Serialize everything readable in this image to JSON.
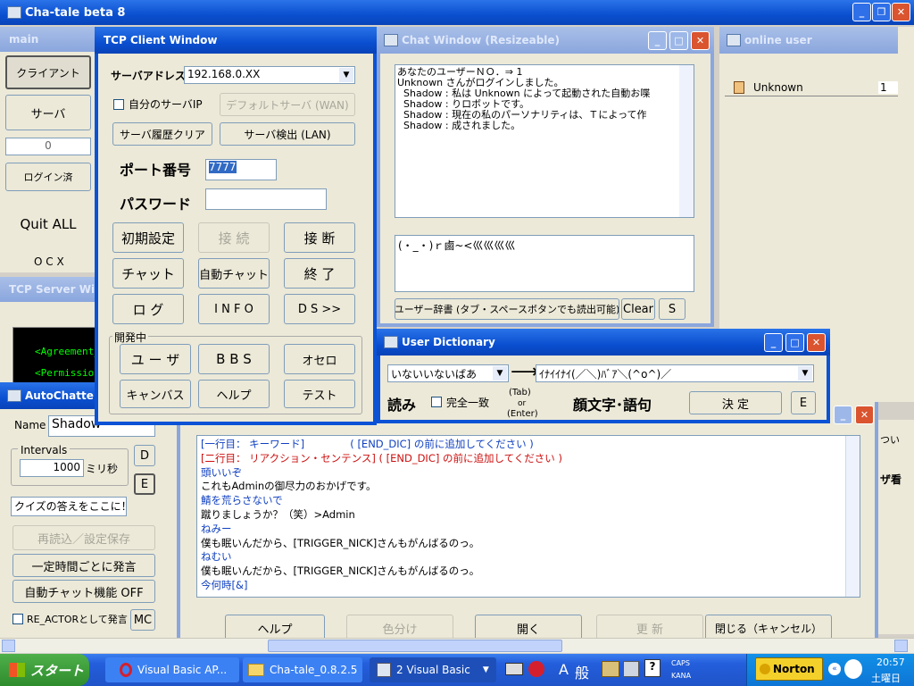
{
  "main_window": {
    "title": "Cha-tale beta 8"
  },
  "main_panel": {
    "title": "main",
    "client_button": "クライアント",
    "server_button": "サーバ",
    "counter": "0",
    "login_button": "ログイン済",
    "quit_button": "Quit ALL",
    "ocx_label": "O C X"
  },
  "server_window": {
    "title": "TCP Server Wi",
    "lines": [
      "<Agreement_",
      "<Permission"
    ]
  },
  "autochatter": {
    "title": "AutoChatte",
    "name_label": "Name :",
    "name_value": "Shadow",
    "intervals_label": "Intervals",
    "intervals_value": "1000",
    "ms_label": "ミリ秒",
    "d_button": "D",
    "e_button": "E",
    "quiz_input": "クイズの答えをここに！",
    "reload_button": "再読込／設定保存",
    "periodic_button": "一定時間ごとに発言",
    "autochat_button": "自動チャット機能 OFF",
    "reactor_label": "RE_ACTORとして発言",
    "mc_button": "MC"
  },
  "tcp_client": {
    "title": "TCP Client Window",
    "server_address_label": "サーバアドレス",
    "server_address_value": "192.168.0.XX",
    "own_ip_label": "自分のサーバIP",
    "default_server_button": "デフォルトサーバ (WAN)",
    "clear_history_button": "サーバ履歴クリア",
    "detect_server_button": "サーバ検出 (LAN)",
    "port_label": "ポート番号",
    "port_value": "7777",
    "password_label": "パスワード",
    "init_button": "初期設定",
    "connect_button": "接 続",
    "disconnect_button": "接 断",
    "chat_button": "チャット",
    "autochat_button": "自動チャット",
    "exit_button": "終 了",
    "log_button": "ロ グ",
    "info_button": "I N F O",
    "ds_button": "D S >>",
    "dev_group_label": "開発中",
    "user_button": "ユ ー ザ",
    "bbs_button": "B B S",
    "othello_button": "オセロ",
    "canvas_button": "キャンバス",
    "help_button": "ヘルプ",
    "test_button": "テスト"
  },
  "chat_window": {
    "title": "Chat Window (Resizeable)",
    "log": [
      "あなたのユーザーＮＯ．⇒ 1",
      "Unknown さんがログインしました。",
      "  Shadow : 私は Unknown によって起動された自動お喋",
      "  Shadow : りロボットです。",
      "  Shadow : 現在の私のパーソナリティは、Ｔによって作",
      "  Shadow : 成されました。"
    ],
    "input_text": "(・_・)ｒ鹵~<巛巛巛巛",
    "dict_button": "ユーザー辞書 (タブ・スペースボタンでも読出可能)",
    "clear_button": "Clear",
    "s_button": "S"
  },
  "online_users": {
    "title": "online user",
    "users": [
      {
        "name": "Unknown",
        "count": "1"
      }
    ]
  },
  "user_dictionary": {
    "title": "User Dictionary",
    "reading_value": "いないいないばあ",
    "arrow": "⟶",
    "phrase_value": "ｲﾅｲｲﾅｲ(／＼)ﾊﾞｱ＼(^o^)／",
    "reading_label": "読み",
    "exact_match_label": "完全一致",
    "tab_enter_hint": [
      "(Tab)",
      "or",
      "(Enter)"
    ],
    "phrase_label": "顔文字･語句",
    "decide_button": "決 定",
    "e_button": "E"
  },
  "script_editor": {
    "lines": [
      {
        "text": "[一行目： キーワード]              ( [END_DIC] の前に追加してください )",
        "color": "#1040c0"
      },
      {
        "text": "[二行目： リアクション・センテンス] ( [END_DIC] の前に追加してください )",
        "color": "#cc1010"
      },
      {
        "text": "頭いいぞ",
        "color": "#1040c0"
      },
      {
        "text": "これもAdminの御尽力のおかげです。",
        "color": "#000000"
      },
      {
        "text": "鯖を荒らさないで",
        "color": "#1040c0"
      },
      {
        "text": "蹴りましょうか？（笑）>Admin",
        "color": "#000000"
      },
      {
        "text": "ねみー",
        "color": "#1040c0"
      },
      {
        "text": "僕も眠いんだから、[TRIGGER_NICK]さんもがんばるのっ。",
        "color": "#000000"
      },
      {
        "text": "ねむい",
        "color": "#1040c0"
      },
      {
        "text": "僕も眠いんだから、[TRIGGER_NICK]さんもがんばるのっ。",
        "color": "#000000"
      },
      {
        "text": "今何時[&]",
        "color": "#1040c0"
      }
    ],
    "help_button": "ヘルプ",
    "color_button": "色分け",
    "open_button": "開く",
    "update_button": "更 新",
    "close_button": "閉じる（キャンセル）"
  },
  "right_partial": {
    "text1": "つい",
    "text2": "ザ看"
  },
  "taskbar": {
    "start_label": "スタート",
    "tasks": [
      "Visual Basic AP...",
      "Cha-tale_0.8.2.5",
      "2 Visual Basic"
    ],
    "ime_a": "A",
    "ime_mode": "般",
    "caps": "CAPS",
    "kana": "KANA",
    "norton": "Norton",
    "time": "20:57",
    "day": "土曜日"
  }
}
